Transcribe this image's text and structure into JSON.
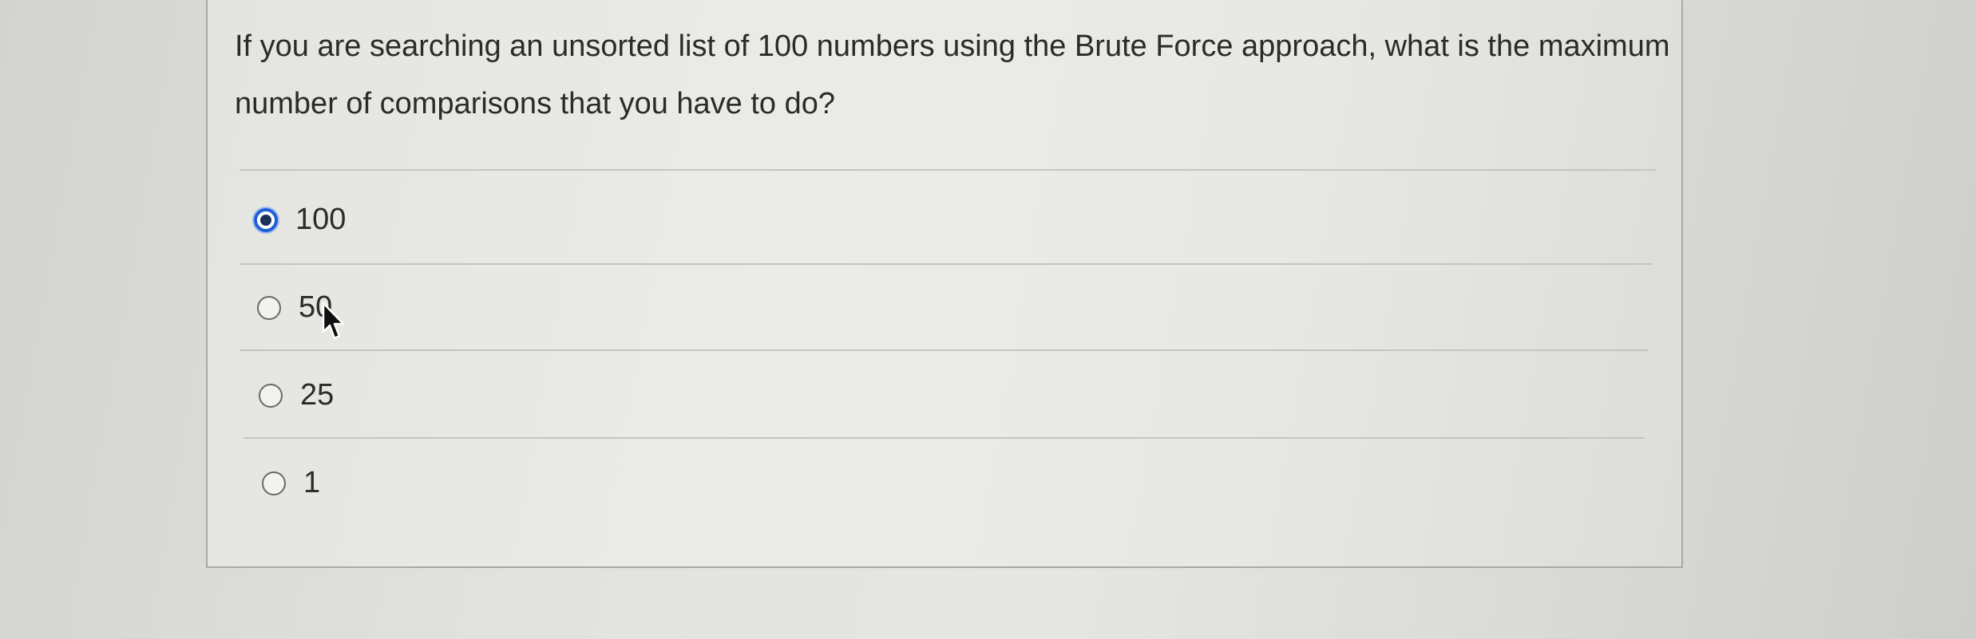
{
  "question": {
    "text": "If you are searching an unsorted list of 100 numbers using the Brute Force approach, what is the maximum number of comparisons that you have to do?"
  },
  "options": [
    {
      "label": "100",
      "selected": true
    },
    {
      "label": "50",
      "selected": false
    },
    {
      "label": "25",
      "selected": false
    },
    {
      "label": "1",
      "selected": false
    }
  ],
  "colors": {
    "accent": "#1f5fd6",
    "text": "#2b2b2b",
    "divider": "#c4c4c0"
  },
  "icons": {
    "cursor": "arrow-cursor-icon"
  }
}
